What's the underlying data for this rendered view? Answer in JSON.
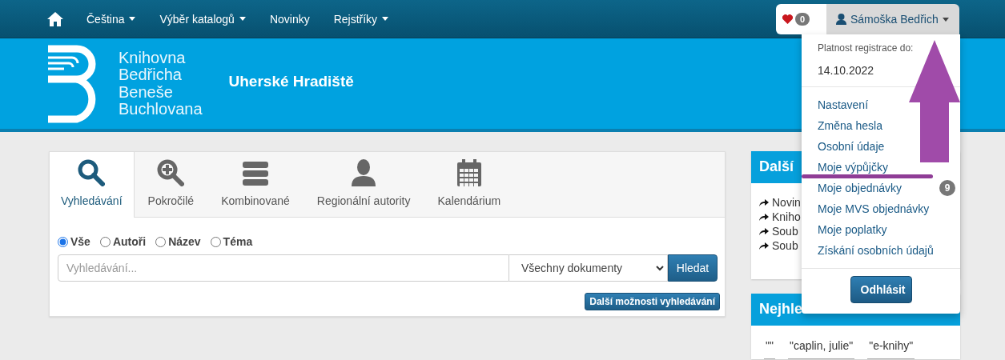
{
  "nav": {
    "items": [
      {
        "label": "Čeština",
        "dropdown": true
      },
      {
        "label": "Výběr katalogů",
        "dropdown": true
      },
      {
        "label": "Novinky",
        "dropdown": false
      },
      {
        "label": "Rejstříky",
        "dropdown": true
      }
    ],
    "favorites": {
      "count": "0"
    },
    "user": {
      "name": "Sámoška Bedřich",
      "annotated": true
    }
  },
  "banner": {
    "logo_lines": [
      "Knihovna",
      "Bedřicha",
      "Beneše",
      "Buchlovana"
    ],
    "city": "Uherské Hradiště"
  },
  "search": {
    "tabs": [
      {
        "label": "Vyhledávání",
        "kind": "search",
        "selected": true
      },
      {
        "label": "Pokročilé",
        "kind": "advanced",
        "selected": false
      },
      {
        "label": "Kombinované",
        "kind": "combined",
        "selected": false
      },
      {
        "label": "Regionální autority",
        "kind": "person",
        "selected": false
      },
      {
        "label": "Kalendárium",
        "kind": "calendar",
        "selected": false
      }
    ],
    "scopes": [
      {
        "label": "Vše",
        "selected": true
      },
      {
        "label": "Autoři",
        "selected": false
      },
      {
        "label": "Název",
        "selected": false
      },
      {
        "label": "Téma",
        "selected": false
      }
    ],
    "query": {
      "placeholder": "Vyhledávání..."
    },
    "document_type": {
      "value": "Všechny dokumenty"
    },
    "submit": "Hledat",
    "more_options": "Další možnosti vyhledávání"
  },
  "sidebar": {
    "panels": [
      {
        "title": "Další",
        "kind": "links",
        "items": [
          "Novin",
          "Kniho",
          "Soub",
          "Soub"
        ]
      },
      {
        "title": "Nejhle",
        "kind": "tags",
        "items": [
          "\"\"",
          "\"caplin, julie\"",
          "\"e-knihy\""
        ]
      }
    ]
  },
  "user_menu": {
    "validity_label": "Platnost registrace do:",
    "validity_date": "14.10.2022",
    "items": [
      {
        "label": "Nastavení",
        "underlined": false
      },
      {
        "label": "Změna hesla",
        "underlined": false
      },
      {
        "label": "Osobní údaje",
        "underlined": false
      },
      {
        "label": "Moje výpůjčky",
        "underlined": true
      },
      {
        "label": "Moje objednávky",
        "badge": "9",
        "underlined": false
      },
      {
        "label": "Moje MVS objednávky",
        "underlined": false
      },
      {
        "label": "Moje poplatky",
        "underlined": false
      },
      {
        "label": "Získání osobních údajů",
        "underlined": false
      }
    ],
    "logout": "Odhlásit"
  }
}
